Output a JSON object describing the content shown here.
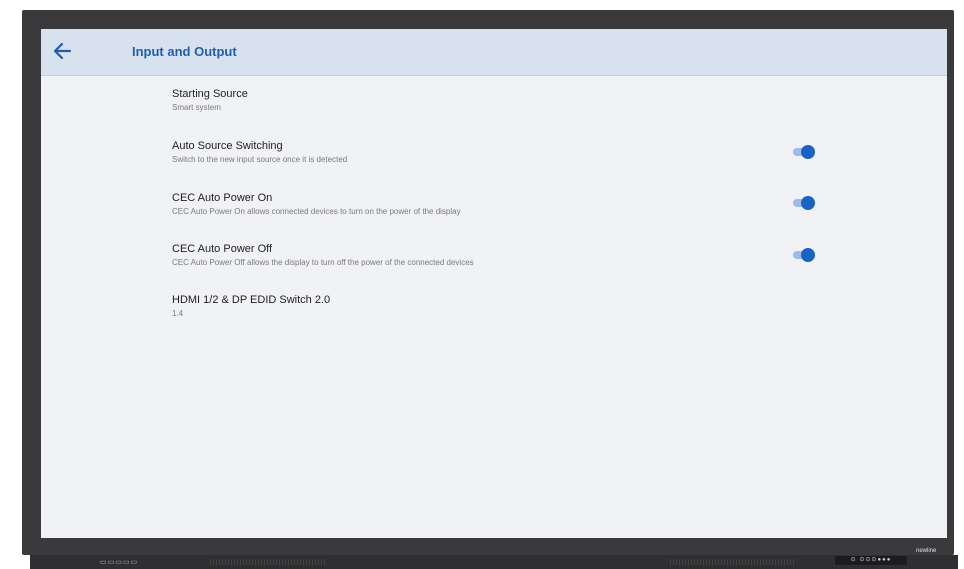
{
  "header": {
    "title": "Input and Output",
    "back_icon": "arrow-left-icon"
  },
  "settings": [
    {
      "title": "Starting Source",
      "subtitle": "Smart system"
    },
    {
      "title": "Auto Source Switching",
      "subtitle": "Switch to the new input source once it is detected",
      "toggle": true
    },
    {
      "title": "CEC Auto Power On",
      "subtitle": "CEC Auto Power On allows connected devices to turn on the power of the display",
      "toggle": true
    },
    {
      "title": "CEC Auto Power Off",
      "subtitle": "CEC Auto Power Off allows the display to turn off the power of the connected devices",
      "toggle": true
    },
    {
      "title": "HDMI 1/2 & DP EDID Switch 2.0",
      "subtitle": "1.4"
    }
  ],
  "device": {
    "brand": "newline",
    "button_strip": "⊙ ⊙⊙⊙●●●"
  },
  "colors": {
    "accent": "#1a63c6",
    "header_bg": "#d8e1ee",
    "screen_bg": "#f1f2f6",
    "bezel": "#3a3a3c"
  }
}
